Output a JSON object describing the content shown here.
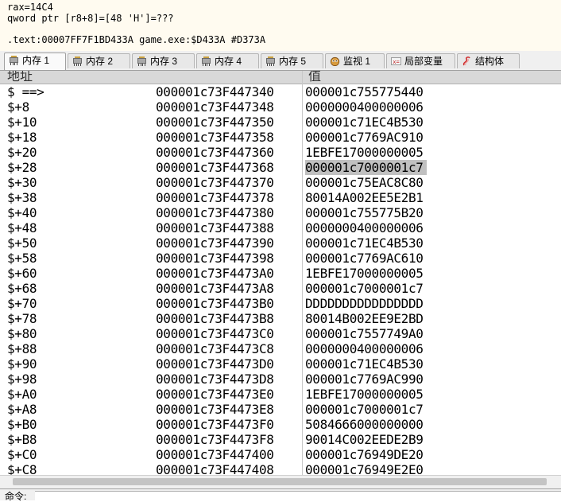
{
  "info": {
    "line1": "rax=14C4",
    "line2": "qword ptr [r8+8]=[48 'H']=???",
    "line3": ".text:00007FF7F1BD433A game.exe:$D433A #D373A"
  },
  "tabs": [
    {
      "label": "内存 1",
      "icon": "memory-chip-icon",
      "active": true
    },
    {
      "label": "内存 2",
      "icon": "memory-chip-icon",
      "active": false
    },
    {
      "label": "内存 3",
      "icon": "memory-chip-icon",
      "active": false
    },
    {
      "label": "内存 4",
      "icon": "memory-chip-icon",
      "active": false
    },
    {
      "label": "内存 5",
      "icon": "memory-chip-icon",
      "active": false
    },
    {
      "label": "监视 1",
      "icon": "watch-icon",
      "active": false
    },
    {
      "label": "局部变量",
      "icon": "locals-icon",
      "active": false
    },
    {
      "label": "结构体",
      "icon": "struct-icon",
      "active": false
    }
  ],
  "columns": {
    "address": "地址",
    "value": "值"
  },
  "rows": [
    {
      "label": "$ ==>",
      "addr": "000001c73F447340",
      "val": "000001c755775440"
    },
    {
      "label": "$+8",
      "addr": "000001c73F447348",
      "val": "0000000400000006"
    },
    {
      "label": "$+10",
      "addr": "000001c73F447350",
      "val": "000001c71EC4B530"
    },
    {
      "label": "$+18",
      "addr": "000001c73F447358",
      "val": "000001c7769AC910"
    },
    {
      "label": "$+20",
      "addr": "000001c73F447360",
      "val": "1EBFE17000000005"
    },
    {
      "label": "$+28",
      "addr": "000001c73F447368",
      "val": "000001c7000001c7",
      "selected": true
    },
    {
      "label": "$+30",
      "addr": "000001c73F447370",
      "val": "000001c75EAC8C80"
    },
    {
      "label": "$+38",
      "addr": "000001c73F447378",
      "val": "80014A002EE5E2B1"
    },
    {
      "label": "$+40",
      "addr": "000001c73F447380",
      "val": "000001c755775B20"
    },
    {
      "label": "$+48",
      "addr": "000001c73F447388",
      "val": "0000000400000006"
    },
    {
      "label": "$+50",
      "addr": "000001c73F447390",
      "val": "000001c71EC4B530"
    },
    {
      "label": "$+58",
      "addr": "000001c73F447398",
      "val": "000001c7769AC610"
    },
    {
      "label": "$+60",
      "addr": "000001c73F4473A0",
      "val": "1EBFE17000000005"
    },
    {
      "label": "$+68",
      "addr": "000001c73F4473A8",
      "val": "000001c7000001c7"
    },
    {
      "label": "$+70",
      "addr": "000001c73F4473B0",
      "val": "DDDDDDDDDDDDDDDD"
    },
    {
      "label": "$+78",
      "addr": "000001c73F4473B8",
      "val": "80014B002EE9E2BD"
    },
    {
      "label": "$+80",
      "addr": "000001c73F4473C0",
      "val": "000001c7557749A0"
    },
    {
      "label": "$+88",
      "addr": "000001c73F4473C8",
      "val": "0000000400000006"
    },
    {
      "label": "$+90",
      "addr": "000001c73F4473D0",
      "val": "000001c71EC4B530"
    },
    {
      "label": "$+98",
      "addr": "000001c73F4473D8",
      "val": "000001c7769AC990"
    },
    {
      "label": "$+A0",
      "addr": "000001c73F4473E0",
      "val": "1EBFE17000000005"
    },
    {
      "label": "$+A8",
      "addr": "000001c73F4473E8",
      "val": "000001c7000001c7"
    },
    {
      "label": "$+B0",
      "addr": "000001c73F4473F0",
      "val": "5084666000000000"
    },
    {
      "label": "$+B8",
      "addr": "000001c73F4473F8",
      "val": "90014C002EEDE2B9"
    },
    {
      "label": "$+C0",
      "addr": "000001c73F447400",
      "val": "000001c76949DE20"
    },
    {
      "label": "$+C8",
      "addr": "000001c73F447408",
      "val": "000001c76949E2E0"
    }
  ],
  "command": {
    "label": "命令:"
  },
  "colors": {
    "info_bg": "#fffbf0",
    "selection": "#c0c0c0",
    "header_bg": "#d8d8d8"
  }
}
